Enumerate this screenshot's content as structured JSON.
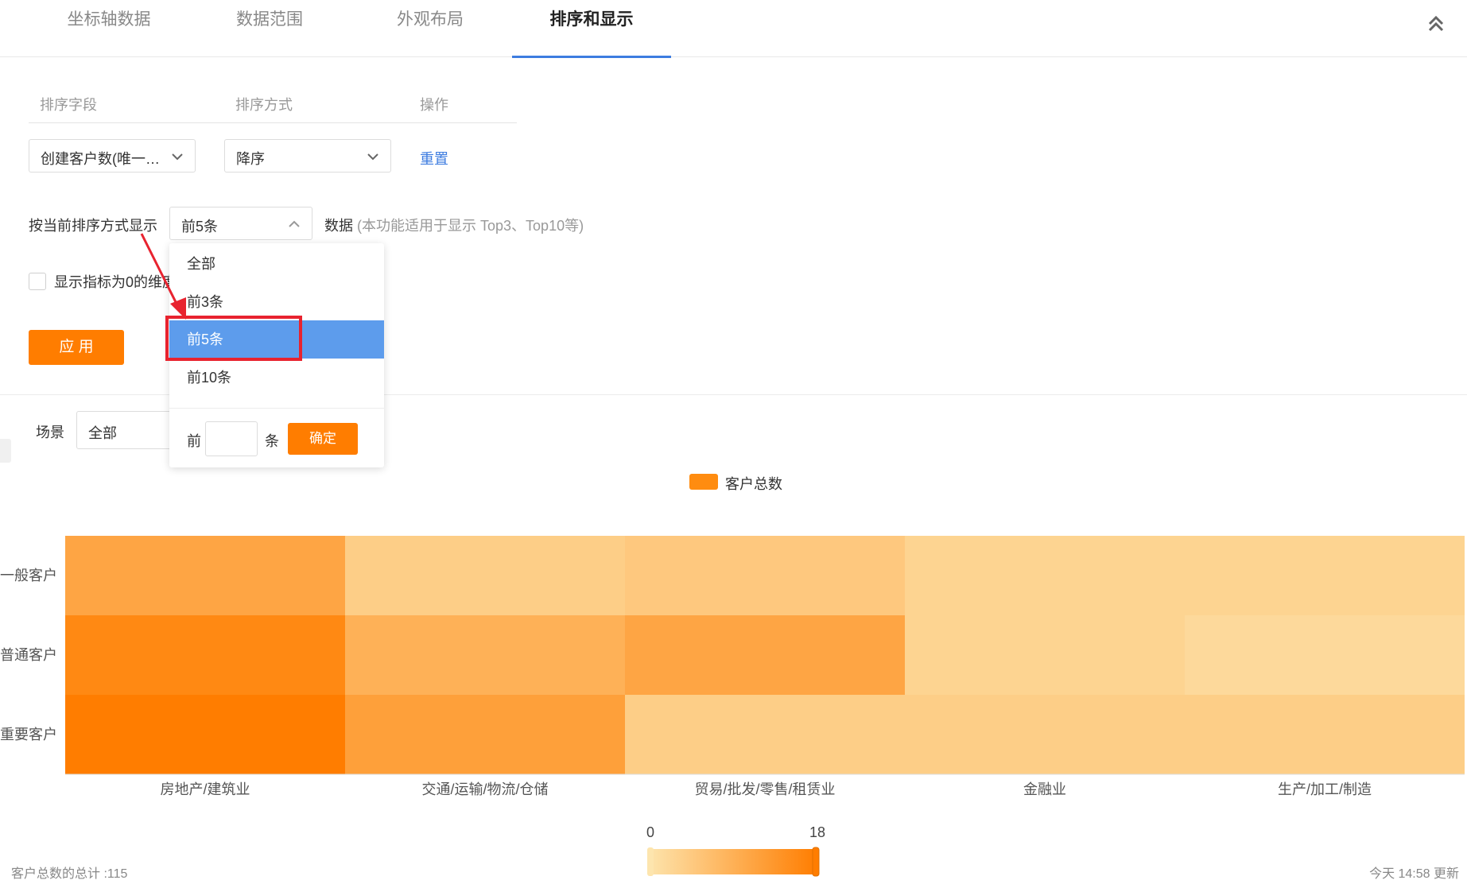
{
  "tabs": [
    {
      "label": "坐标轴数据",
      "active": false
    },
    {
      "label": "数据范围",
      "active": false
    },
    {
      "label": "外观布局",
      "active": false
    },
    {
      "label": "排序和显示",
      "active": true
    }
  ],
  "sort": {
    "headers": {
      "field": "排序字段",
      "method": "排序方式",
      "action": "操作"
    },
    "field_value": "创建客户数(唯一…",
    "method_value": "降序",
    "reset_label": "重置"
  },
  "display": {
    "prefix": "按当前排序方式显示",
    "selected": "前5条",
    "suffix": "数据",
    "hint": "(本功能适用于显示 Top3、Top10等)"
  },
  "dropdown": {
    "options": [
      "全部",
      "前3条",
      "前5条",
      "前10条"
    ],
    "selected_index": 2,
    "custom_prefix": "前",
    "custom_value": "",
    "custom_suffix": "条",
    "confirm_label": "确定"
  },
  "show_zero": {
    "label": "显示指标为0的维度",
    "checked": false
  },
  "apply_label": "应 用",
  "scene": {
    "label": "场景",
    "value": "全部"
  },
  "colors": {
    "accent": "#ff7d00",
    "link": "#3d7ce0",
    "selected": "#5d9cec",
    "highlight": "#e8232f"
  },
  "chart_data": {
    "type": "heatmap",
    "legend": [
      "客户总数"
    ],
    "x_categories": [
      "房地产/建筑业",
      "交通/运输/物流/仓储",
      "贸易/批发/零售/租赁业",
      "金融业",
      "生产/加工/制造"
    ],
    "y_categories": [
      "一般客户",
      "普通客户",
      "重要客户"
    ],
    "values": [
      [
        11,
        4,
        5,
        3,
        3
      ],
      [
        16,
        9,
        11,
        3,
        2
      ],
      [
        18,
        12,
        4,
        4,
        4
      ]
    ],
    "scale_min": 0,
    "scale_max": 18,
    "color_low": "#fde5ae",
    "color_high": "#ff7d00"
  },
  "footer": {
    "total": "客户总数的总计 :115",
    "updated": "今天 14:58 更新"
  }
}
